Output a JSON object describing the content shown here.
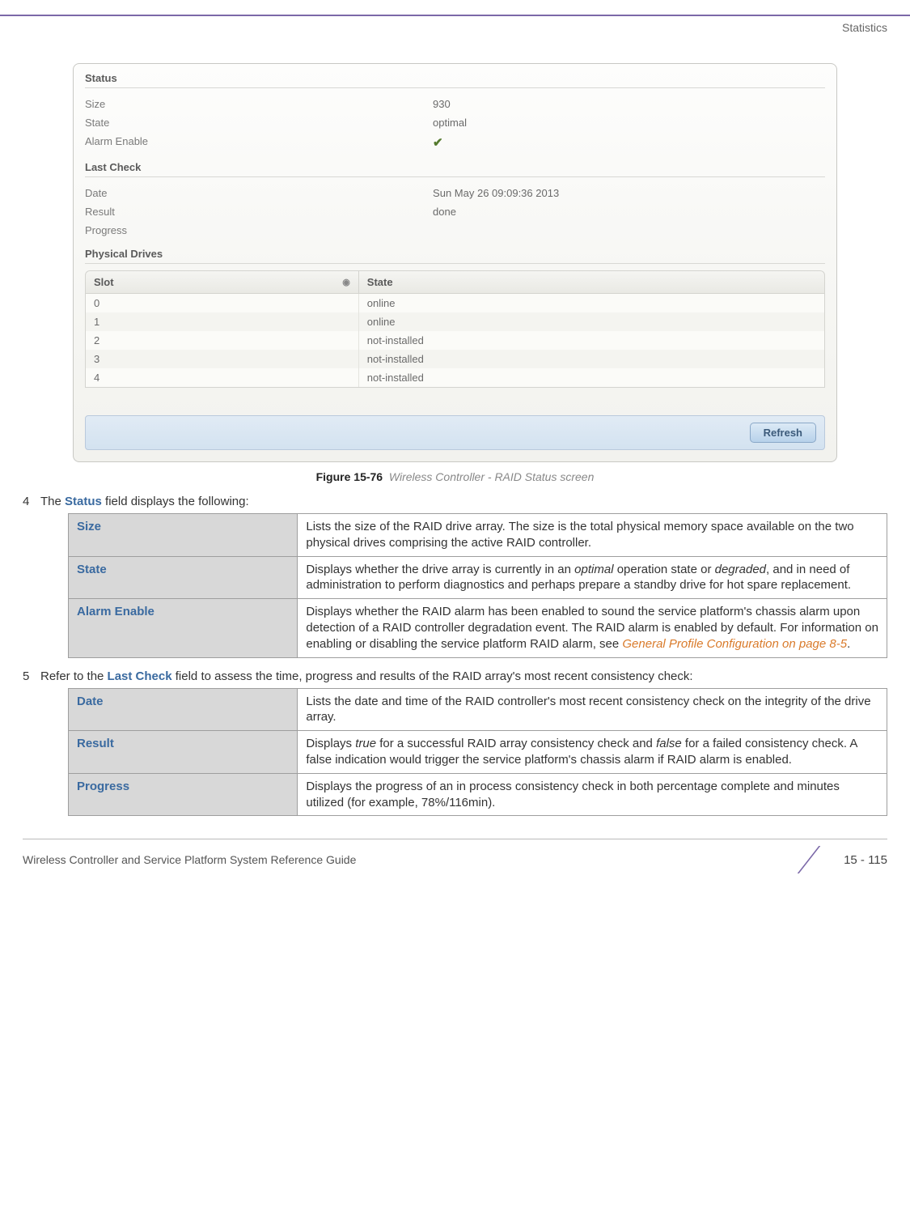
{
  "header": {
    "section_label": "Statistics"
  },
  "screenshot": {
    "status": {
      "legend": "Status",
      "rows": [
        {
          "k": "Size",
          "v": "930"
        },
        {
          "k": "State",
          "v": "optimal"
        },
        {
          "k": "Alarm Enable",
          "v_icon": "checkmark"
        }
      ]
    },
    "lastcheck": {
      "legend": "Last Check",
      "rows": [
        {
          "k": "Date",
          "v": "Sun May 26 09:09:36 2013"
        },
        {
          "k": "Result",
          "v": "done"
        },
        {
          "k": "Progress",
          "v": ""
        }
      ]
    },
    "drives": {
      "legend": "Physical Drives",
      "columns": {
        "slot": "Slot",
        "state": "State"
      },
      "rows": [
        {
          "slot": "0",
          "state": "online"
        },
        {
          "slot": "1",
          "state": "online"
        },
        {
          "slot": "2",
          "state": "not-installed"
        },
        {
          "slot": "3",
          "state": "not-installed"
        },
        {
          "slot": "4",
          "state": "not-installed"
        }
      ]
    },
    "refresh_label": "Refresh"
  },
  "figure": {
    "prefix": "Figure 15-76",
    "title": "Wireless Controller - RAID Status screen"
  },
  "step4": {
    "num": "4",
    "intro_pre": "The ",
    "keyword": "Status",
    "intro_post": " field displays the following:",
    "rows": [
      {
        "term": "Size",
        "desc": "Lists the size of the RAID drive array. The size is the total physical memory space available on the two physical drives comprising the active RAID controller."
      },
      {
        "term": "State",
        "desc_pre": "Displays whether the drive array is currently in an ",
        "em1": "optimal",
        "desc_mid": " operation state or ",
        "em2": "degraded",
        "desc_post": ", and in need of administration to perform diagnostics and perhaps prepare a standby drive for hot spare replacement."
      },
      {
        "term": "Alarm Enable",
        "desc_pre": "Displays whether the RAID alarm has been enabled to sound the service platform's chassis alarm upon detection of a RAID controller degradation event. The RAID alarm is enabled by default. For information on enabling or disabling the service platform RAID alarm, see ",
        "xref": "General Profile Configuration on page 8-5",
        "desc_post": "."
      }
    ]
  },
  "step5": {
    "num": "5",
    "intro_pre": "Refer to the ",
    "keyword": "Last Check",
    "intro_post": " field to assess the time, progress and results of the RAID array's most recent consistency check:",
    "rows": [
      {
        "term": "Date",
        "desc": "Lists the date and time of the RAID controller's most recent consistency check on the integrity of the drive array."
      },
      {
        "term": "Result",
        "desc_pre": "Displays ",
        "em1": "true",
        "desc_mid": " for a successful RAID array consistency check and ",
        "em2": "false",
        "desc_post": " for a failed consistency check. A false indication would trigger the service platform's chassis alarm if RAID alarm is enabled."
      },
      {
        "term": "Progress",
        "desc": "Displays the progress of an in process consistency check in both percentage complete and minutes utilized (for example, 78%/116min)."
      }
    ]
  },
  "footer": {
    "doc_title": "Wireless Controller and Service Platform System Reference Guide",
    "page": "15 - 115"
  }
}
